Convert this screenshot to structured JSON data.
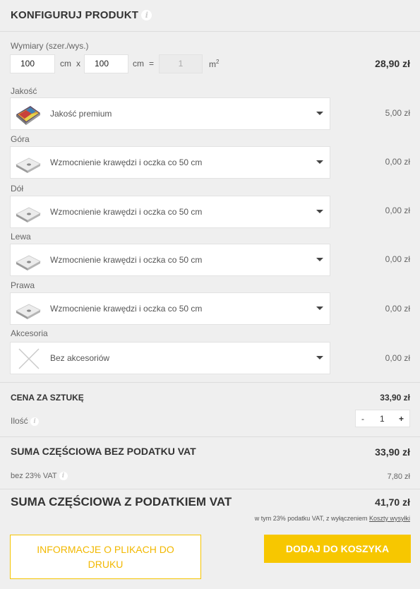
{
  "header": {
    "title": "KONFIGURUJ PRODUKT",
    "info_glyph": "i"
  },
  "dimensions": {
    "label": "Wymiary (szer./wys.)",
    "width_value": "100",
    "unit_cm_1": "cm",
    "times": "x",
    "height_value": "100",
    "unit_cm_2": "cm",
    "equals": "=",
    "area_value": "1",
    "unit_m2": "m",
    "unit_m2_sup": "2",
    "price": "28,90 zł"
  },
  "options": [
    {
      "label": "Jakość",
      "selected": "Jakość premium",
      "price": "5,00 zł",
      "icon": "premium-print-icon"
    },
    {
      "label": "Góra",
      "selected": "Wzmocnienie krawędzi i oczka co 50 cm",
      "price": "0,00 zł",
      "icon": "eyelet-edge-icon"
    },
    {
      "label": "Dół",
      "selected": "Wzmocnienie krawędzi i oczka co 50 cm",
      "price": "0,00 zł",
      "icon": "eyelet-edge-icon"
    },
    {
      "label": "Lewa",
      "selected": "Wzmocnienie krawędzi i oczka co 50 cm",
      "price": "0,00 zł",
      "icon": "eyelet-edge-icon"
    },
    {
      "label": "Prawa",
      "selected": "Wzmocnienie krawędzi i oczka co 50 cm",
      "price": "0,00 zł",
      "icon": "eyelet-edge-icon"
    },
    {
      "label": "Akcesoria",
      "selected": "Bez akcesoriów",
      "price": "0,00 zł",
      "icon": "none-cross-icon"
    }
  ],
  "unit_price": {
    "label": "CENA ZA SZTUKĘ",
    "value": "33,90 zł"
  },
  "quantity": {
    "label": "Ilość",
    "minus": "-",
    "value": "1",
    "plus": "+"
  },
  "subtotal_net": {
    "label": "SUMA CZĘŚCIOWA BEZ PODATKU VAT",
    "value": "33,90 zł"
  },
  "vat": {
    "label": "bez 23% VAT",
    "value": "7,80 zł"
  },
  "subtotal_gross": {
    "label": "SUMA CZĘŚCIOWA Z PODATKIEM VAT",
    "value": "41,70 zł"
  },
  "vat_note": {
    "text": "w tym 23% podatku VAT, z wyłączeniem ",
    "link": "Koszty wysyłki"
  },
  "buttons": {
    "info_line1": "INFORMACJE O PLIKACH DO",
    "info_line2": "DRUKU",
    "add_to_cart": "DODAJ DO KOSZYKA"
  },
  "colors": {
    "accent": "#f7c700",
    "panel_bg": "#efefef"
  }
}
